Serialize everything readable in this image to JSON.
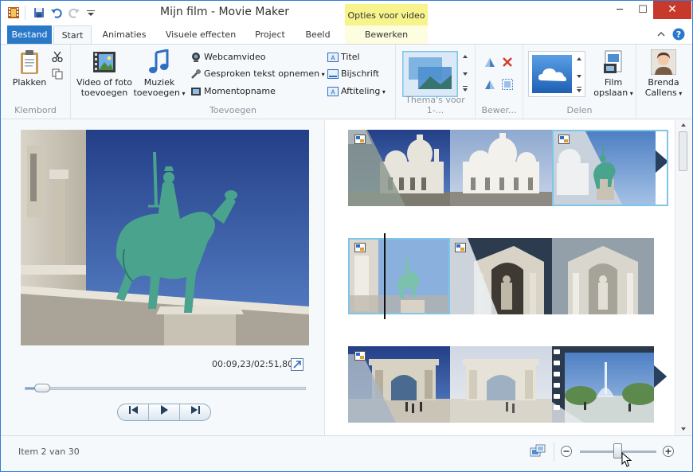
{
  "window": {
    "title": "Mijn film - Movie Maker",
    "context_tab_header": "Opties voor video",
    "minimize": "─",
    "maximize": "☐",
    "close": "✕"
  },
  "tabs": [
    {
      "label": "Bestand"
    },
    {
      "label": "Start"
    },
    {
      "label": "Animaties"
    },
    {
      "label": "Visuele effecten"
    },
    {
      "label": "Project"
    },
    {
      "label": "Beeld"
    },
    {
      "label": "Bewerken"
    }
  ],
  "ribbon": {
    "clipboard": {
      "label": "Klembord",
      "paste": "Plakken"
    },
    "add": {
      "label": "Toevoegen",
      "video_photo": "Video of foto toevoegen",
      "music": "Muziek toevoegen",
      "webcam": "Webcamvideo",
      "narration": "Gesproken tekst opnemen",
      "snapshot": "Momentopname",
      "title": "Titel",
      "caption": "Bijschrift",
      "credits": "Aftiteling"
    },
    "themes": {
      "label": "Thema's voor 1-..."
    },
    "edit": {
      "label": "Bewer..."
    },
    "share": {
      "label": "Delen",
      "save_movie": "Film opslaan",
      "user": "Brenda Callens"
    }
  },
  "preview": {
    "timecode": "00:09,23/02:51,80",
    "seek_position": 0.06
  },
  "status": {
    "item": "Item 2 van 30",
    "zoom_position": 0.5
  },
  "colors": {
    "accent": "#2a78c8",
    "context_tab": "#f7f48c",
    "close": "#c7392b",
    "selection": "#7fc5ea"
  }
}
